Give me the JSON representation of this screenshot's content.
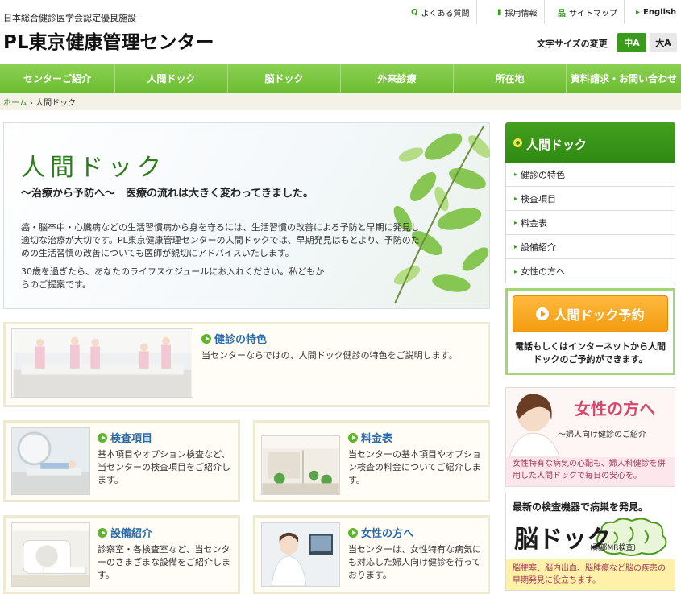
{
  "header": {
    "certification": "日本総合健診医学会認定優良施設",
    "logo": "PL東京健康管理センター",
    "util_links": [
      "よくある質問",
      "採用情報",
      "サイトマップ",
      "English"
    ],
    "font_size_label": "文字サイズの変更",
    "font_size_medium": "中A",
    "font_size_large": "大A"
  },
  "nav": [
    "センターご紹介",
    "人間ドック",
    "脳ドック",
    "外来診療",
    "所在地",
    "資料請求・お問い合わせ"
  ],
  "breadcrumb": {
    "home": "ホーム",
    "separator": "›",
    "current": "人間ドック"
  },
  "hero": {
    "title": "人間ドック",
    "subtitle": "～治療から予防へ～　医療の流れは大きく変わってきました。",
    "p1": "癌・脳卒中・心臓病などの生活習慣病から身を守るには、生活習慣の改善による予防と早期に発見し適切な治療が大切です。PL東京健康管理センターの人間ドックでは、早期発見はもとより、予防のための生活習慣の改善についても医師が親切にアドバイスいたします。",
    "p2": "30歳を過ぎたら、あなたのライフスケジュールにお入れください。私どもからのご提案です。"
  },
  "cards": {
    "features": {
      "title": "健診の特色",
      "desc": "当センターならではの、人間ドック健診の特色をご説明します。"
    },
    "items": {
      "title": "検査項目",
      "desc": "基本項目やオプション検査など、当センターの検査項目をご紹介します。"
    },
    "fees": {
      "title": "料金表",
      "desc": "当センターの基本項目やオプション検査の料金についてご紹介します。"
    },
    "equipment": {
      "title": "設備紹介",
      "desc": "診察室・各検査室など、当センターのさまざまな設備をご紹介します。"
    },
    "women": {
      "title": "女性の方へ",
      "desc": "当センターは、女性特有な病気にも対応した婦人向け健診を行っております。"
    }
  },
  "sidebar": {
    "title": "人間ドック",
    "items": [
      "健診の特色",
      "検査項目",
      "料金表",
      "設備紹介",
      "女性の方へ"
    ],
    "reserve_button": "人間ドック予約",
    "reserve_text": "電話もしくはインターネットから人間ドックのご予約ができます。",
    "women_banner": {
      "title": "女性の方へ",
      "sub": "～婦人向け健診のご紹介",
      "desc": "女性特有な病気の心配も、婦人科健診を併用した人間ドックで毎日の安心を。"
    },
    "brain_banner": {
      "top": "最新の検査機器で病巣を発見。",
      "title": "脳ドック",
      "badge": "(頭部MR検査)",
      "desc": "脳梗塞、脳内出血、脳腫瘍など脳の疾患の早期発見に役立ちます。"
    }
  },
  "colors": {
    "brand_green": "#3a9a1a",
    "nav_green": "#6cbd30",
    "link_blue": "#2a6aa8",
    "accent_orange": "#f39c12"
  }
}
